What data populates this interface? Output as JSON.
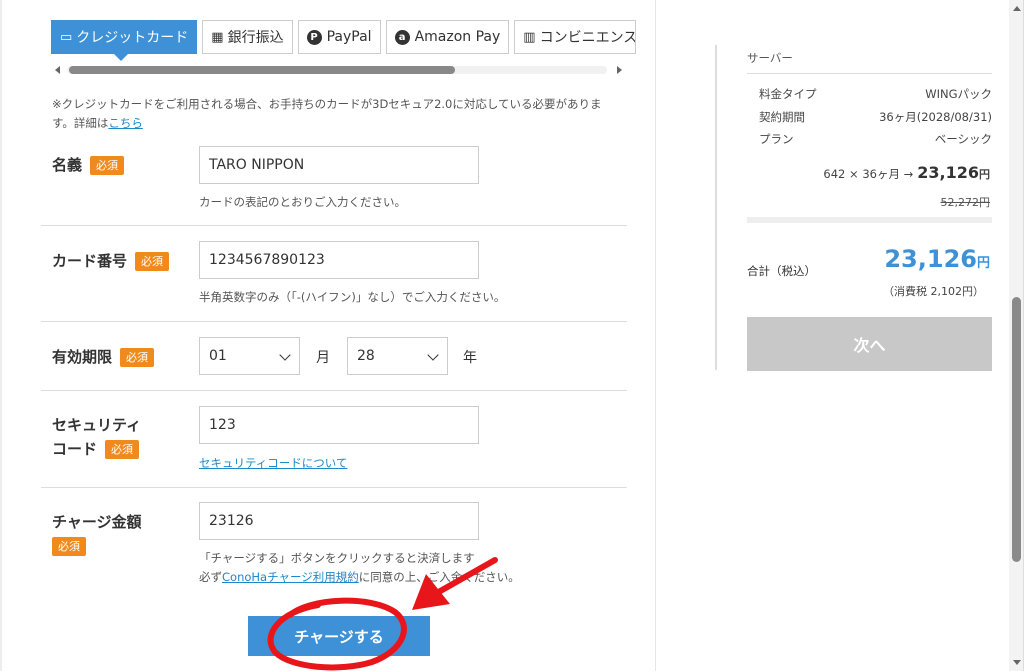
{
  "payment_tabs": [
    {
      "label": "クレジットカード",
      "icon": "credit-card-icon"
    },
    {
      "label": "銀行振込",
      "icon": "bank-icon"
    },
    {
      "label": "PayPal",
      "icon": "paypal-icon"
    },
    {
      "label": "Amazon Pay",
      "icon": "amazon-icon"
    },
    {
      "label": "コンビニエンス",
      "icon": "store-icon"
    }
  ],
  "notice": {
    "text": "※クレジットカードをご利用される場合、お手持ちのカードが3Dセキュア2.0に対応している必要があります。詳細は",
    "link": "こちら"
  },
  "required_badge": "必須",
  "form": {
    "name": {
      "label": "名義",
      "value": "TARO NIPPON",
      "help": "カードの表記のとおりご入力ください。"
    },
    "card_number": {
      "label": "カード番号",
      "value": "1234567890123",
      "help": "半角英数字のみ（「-(ハイフン)」なし）でご入力ください。"
    },
    "expiry": {
      "label": "有効期限",
      "month": "01",
      "month_unit": "月",
      "year": "28",
      "year_unit": "年"
    },
    "security_code": {
      "label_line1": "セキュリティ",
      "label_line2": "コード",
      "value": "123",
      "link": "セキュリティコードについて"
    },
    "charge_amount": {
      "label": "チャージ金額",
      "value": "23126",
      "help_line1": "「チャージする」ボタンをクリックすると決済します",
      "help_line2_prefix": "必ず",
      "help_line2_link": "ConoHaチャージ利用規約",
      "help_line2_suffix": "に同意の上、ご入金ください。"
    },
    "submit": "チャージする"
  },
  "summary": {
    "heading": "サーバー",
    "rows": [
      {
        "key": "料金タイプ",
        "value": "WINGパック"
      },
      {
        "key": "契約期間",
        "value": "36ヶ月(2028/08/31)"
      },
      {
        "key": "プラン",
        "value": "ベーシック"
      }
    ],
    "calc_prefix": "642 × 36ヶ月 →",
    "calc_amount": "23,126",
    "yen": "円",
    "original_price": "52,272円",
    "total_label": "合計（税込）",
    "total_amount": "23,126",
    "tax": "（消費税 2,102円）",
    "next": "次へ"
  },
  "colors": {
    "accent": "#3e91d6",
    "required": "#f08a1c",
    "annotation": "#e8161a",
    "disabled": "#c8c8c8"
  }
}
